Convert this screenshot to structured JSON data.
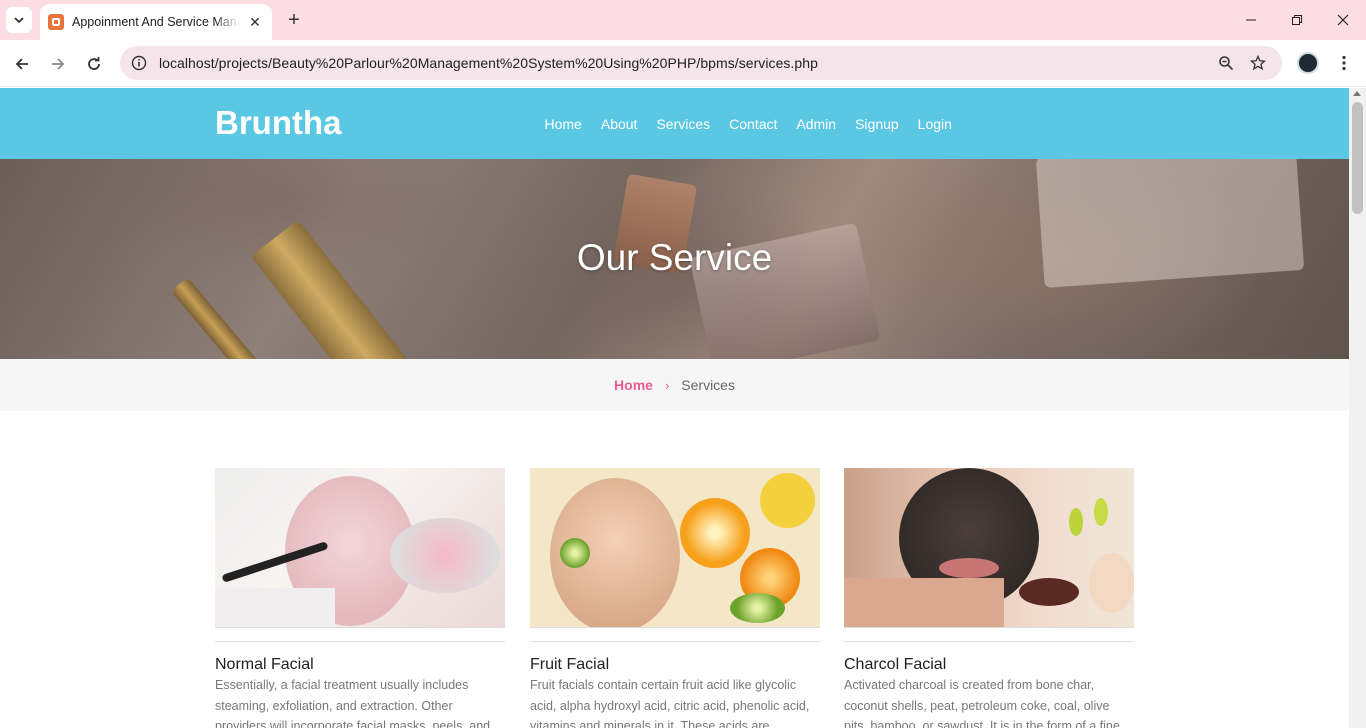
{
  "browser": {
    "tab_title": "Appoinment And Service Management",
    "url": "localhost/projects/Beauty%20Parlour%20Management%20System%20Using%20PHP/bpms/services.php"
  },
  "site": {
    "brand": "Bruntha",
    "nav": [
      "Home",
      "About",
      "Services",
      "Contact",
      "Admin",
      "Signup",
      "Login"
    ],
    "hero_title": "Our Service",
    "breadcrumb": {
      "home": "Home",
      "separator": "›",
      "current": "Services"
    },
    "accent_color": "#5bc8e3",
    "link_color": "#ee5a93"
  },
  "services": [
    {
      "title": "Normal Facial",
      "text": "Essentially, a facial treatment usually includes steaming, exfoliation, and extraction. Other providers will incorporate facial masks, peels, and"
    },
    {
      "title": "Fruit Facial",
      "text": "Fruit facials contain certain fruit acid like glycolic acid, alpha hydroxyl acid, citric acid, phenolic acid, vitamins and minerals in it. These acids are"
    },
    {
      "title": "Charcol Facial",
      "text": "Activated charcoal is created from bone char, coconut shells, peat, petroleum coke, coal, olive pits, bamboo, or sawdust. It is in the form of a fine"
    }
  ]
}
